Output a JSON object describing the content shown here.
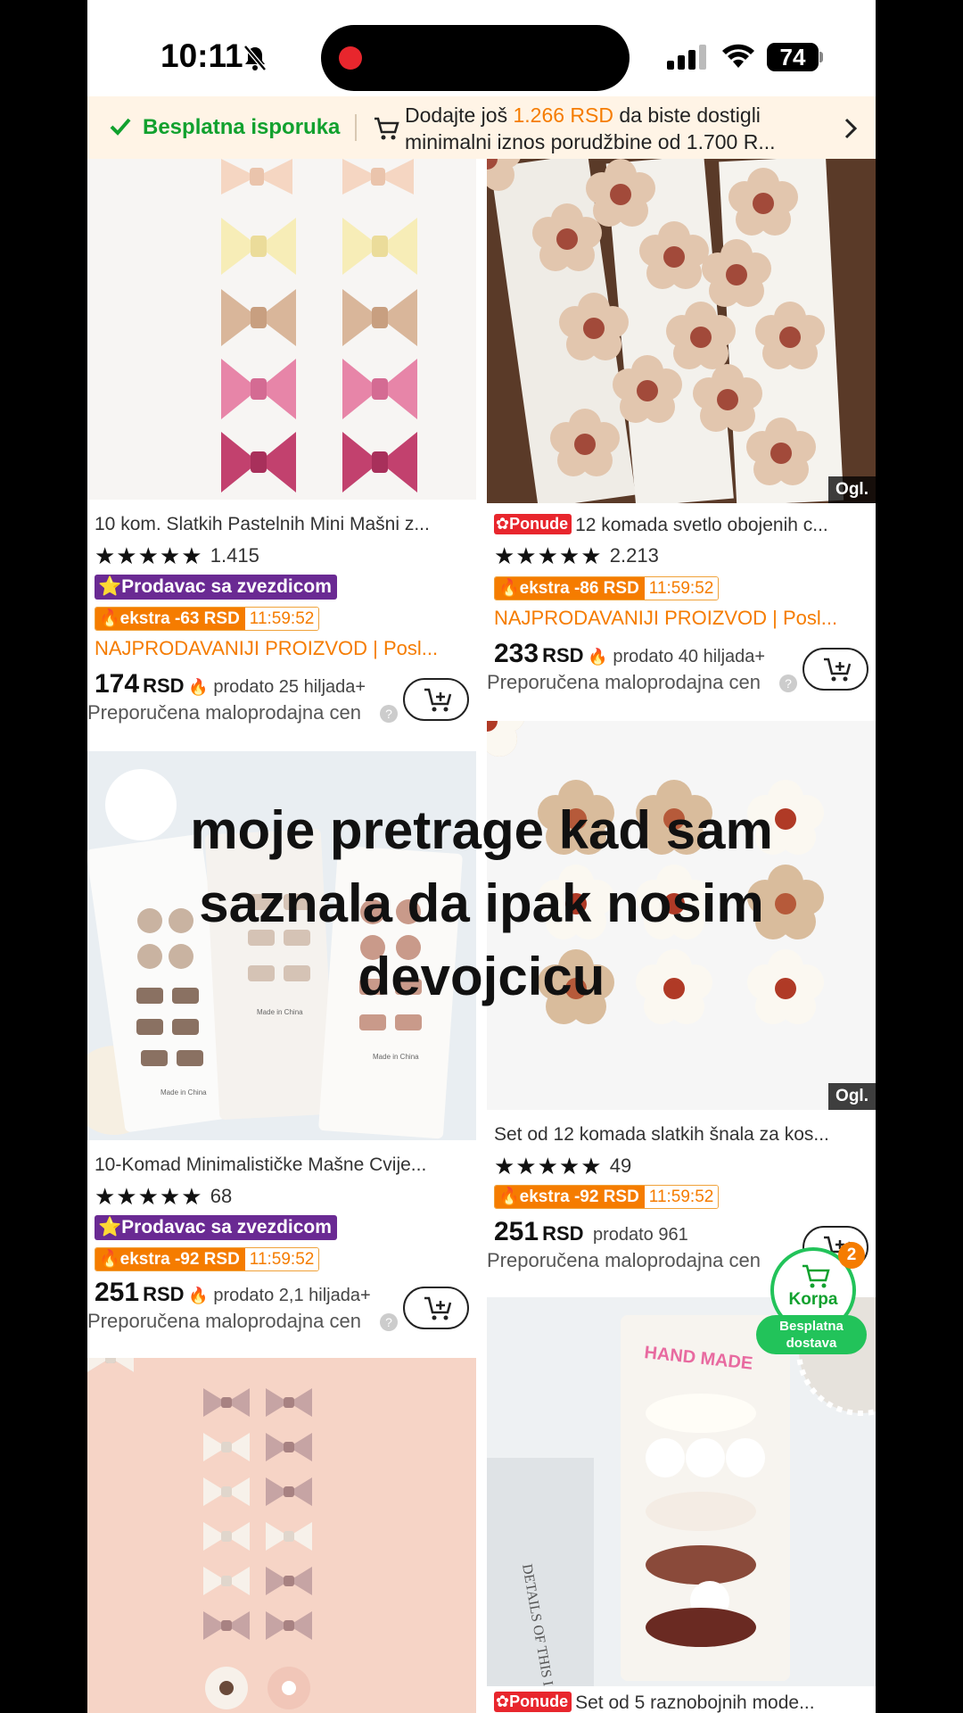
{
  "status_bar": {
    "time": "10:11",
    "battery": "74"
  },
  "banner": {
    "free_shipping": "Besplatna isporuka",
    "message_pre": "Dodajte još ",
    "message_amount": "1.266 RSD",
    "message_post": " da biste dostigli minimalni iznos porudžbine od 1.700 R..."
  },
  "colors": {
    "accent_orange": "#f57c00",
    "green": "#11a12e",
    "seller_purple": "#6a2a93",
    "promo_red": "#e8262d"
  },
  "products": [
    {
      "title": "10 kom. Slatkih Pastelnih Mini Mašni z...",
      "rating_count": "1.415",
      "seller_badge": "Prodavac sa zvezdicom",
      "extra": "ekstra -63 RSD",
      "timer": "11:59:52",
      "bestseller": "NAJPRODAVANIJI PROIZVOD | Posl...",
      "price": "174",
      "currency": "RSD",
      "sold": "prodato 25 hiljada+",
      "recommended": "Preporučena maloprodajna cen"
    },
    {
      "promo": "Ponude",
      "title": "12 komada svetlo obojenih c...",
      "rating_count": "2.213",
      "extra": "ekstra -86 RSD",
      "timer": "11:59:52",
      "bestseller": "NAJPRODAVANIJI PROIZVOD | Posl...",
      "price": "233",
      "currency": "RSD",
      "sold": "prodato 40 hiljada+",
      "recommended": "Preporučena maloprodajna cen",
      "ad": "Ogl."
    },
    {
      "title": "10-Komad Minimalističke Mašne Cvije...",
      "rating_count": "68",
      "seller_badge": "Prodavac sa zvezdicom",
      "extra": "ekstra -92 RSD",
      "timer": "11:59:52",
      "price": "251",
      "currency": "RSD",
      "sold": "prodato 2,1 hiljada+",
      "recommended": "Preporučena maloprodajna cen"
    },
    {
      "title": "Set od 12 komada slatkih šnala za kos...",
      "rating_count": "49",
      "extra": "ekstra -92 RSD",
      "timer": "11:59:52",
      "price": "251",
      "currency": "RSD",
      "sold": "prodato 961",
      "recommended": "Preporučena maloprodajna cen",
      "ad": "Ogl."
    },
    {
      "promo": "Ponude",
      "title": "Set od 5 raznobojnih  mode..."
    }
  ],
  "image_texts": {
    "made_in_china": "Made in China",
    "hand_made": "HAND MADE",
    "details": "DETAILS OF THIS IS"
  },
  "overlay_caption": "moje pretrage kad sam saznala da ipak nosim devojcicu",
  "cart_fab": {
    "label": "Korpa",
    "count": "2",
    "shipping": "Besplatna dostava"
  }
}
